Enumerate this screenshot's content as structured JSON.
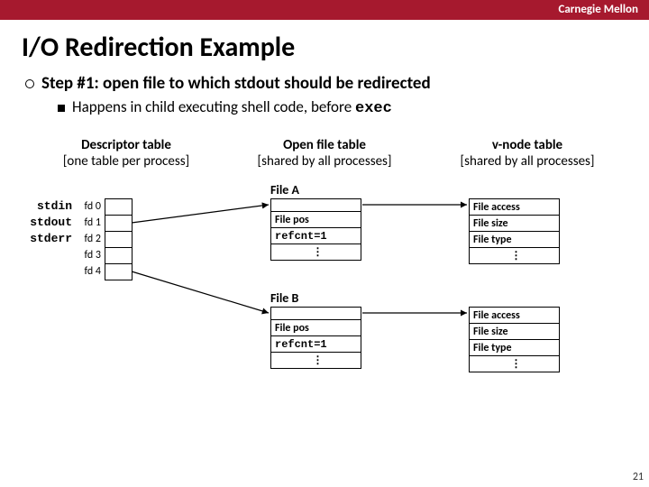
{
  "brand": "Carnegie Mellon",
  "title": "I/O Redirection Example",
  "bullet1": "Step #1: open file to which stdout should be redirected",
  "bullet2_pre": "Happens in child executing shell code, before ",
  "bullet2_code": "exec",
  "headers": {
    "h1a": "Descriptor table",
    "h1b": "[one table per process]",
    "h2a": "Open file table",
    "h2b": "[shared by all processes]",
    "h3a": "v-node table",
    "h3b": "[shared by all processes]"
  },
  "fd": {
    "labels": [
      "stdin",
      "stdout",
      "stderr"
    ],
    "nums": [
      "fd 0",
      "fd 1",
      "fd 2",
      "fd 3",
      "fd 4"
    ]
  },
  "fileA": {
    "label": "File A",
    "pos": "File pos",
    "ref": "refcnt=1"
  },
  "fileB": {
    "label": "File B",
    "pos": "File pos",
    "ref": "refcnt=1"
  },
  "vnode": {
    "access": "File access",
    "size": "File size",
    "type": "File type"
  },
  "page": "21"
}
